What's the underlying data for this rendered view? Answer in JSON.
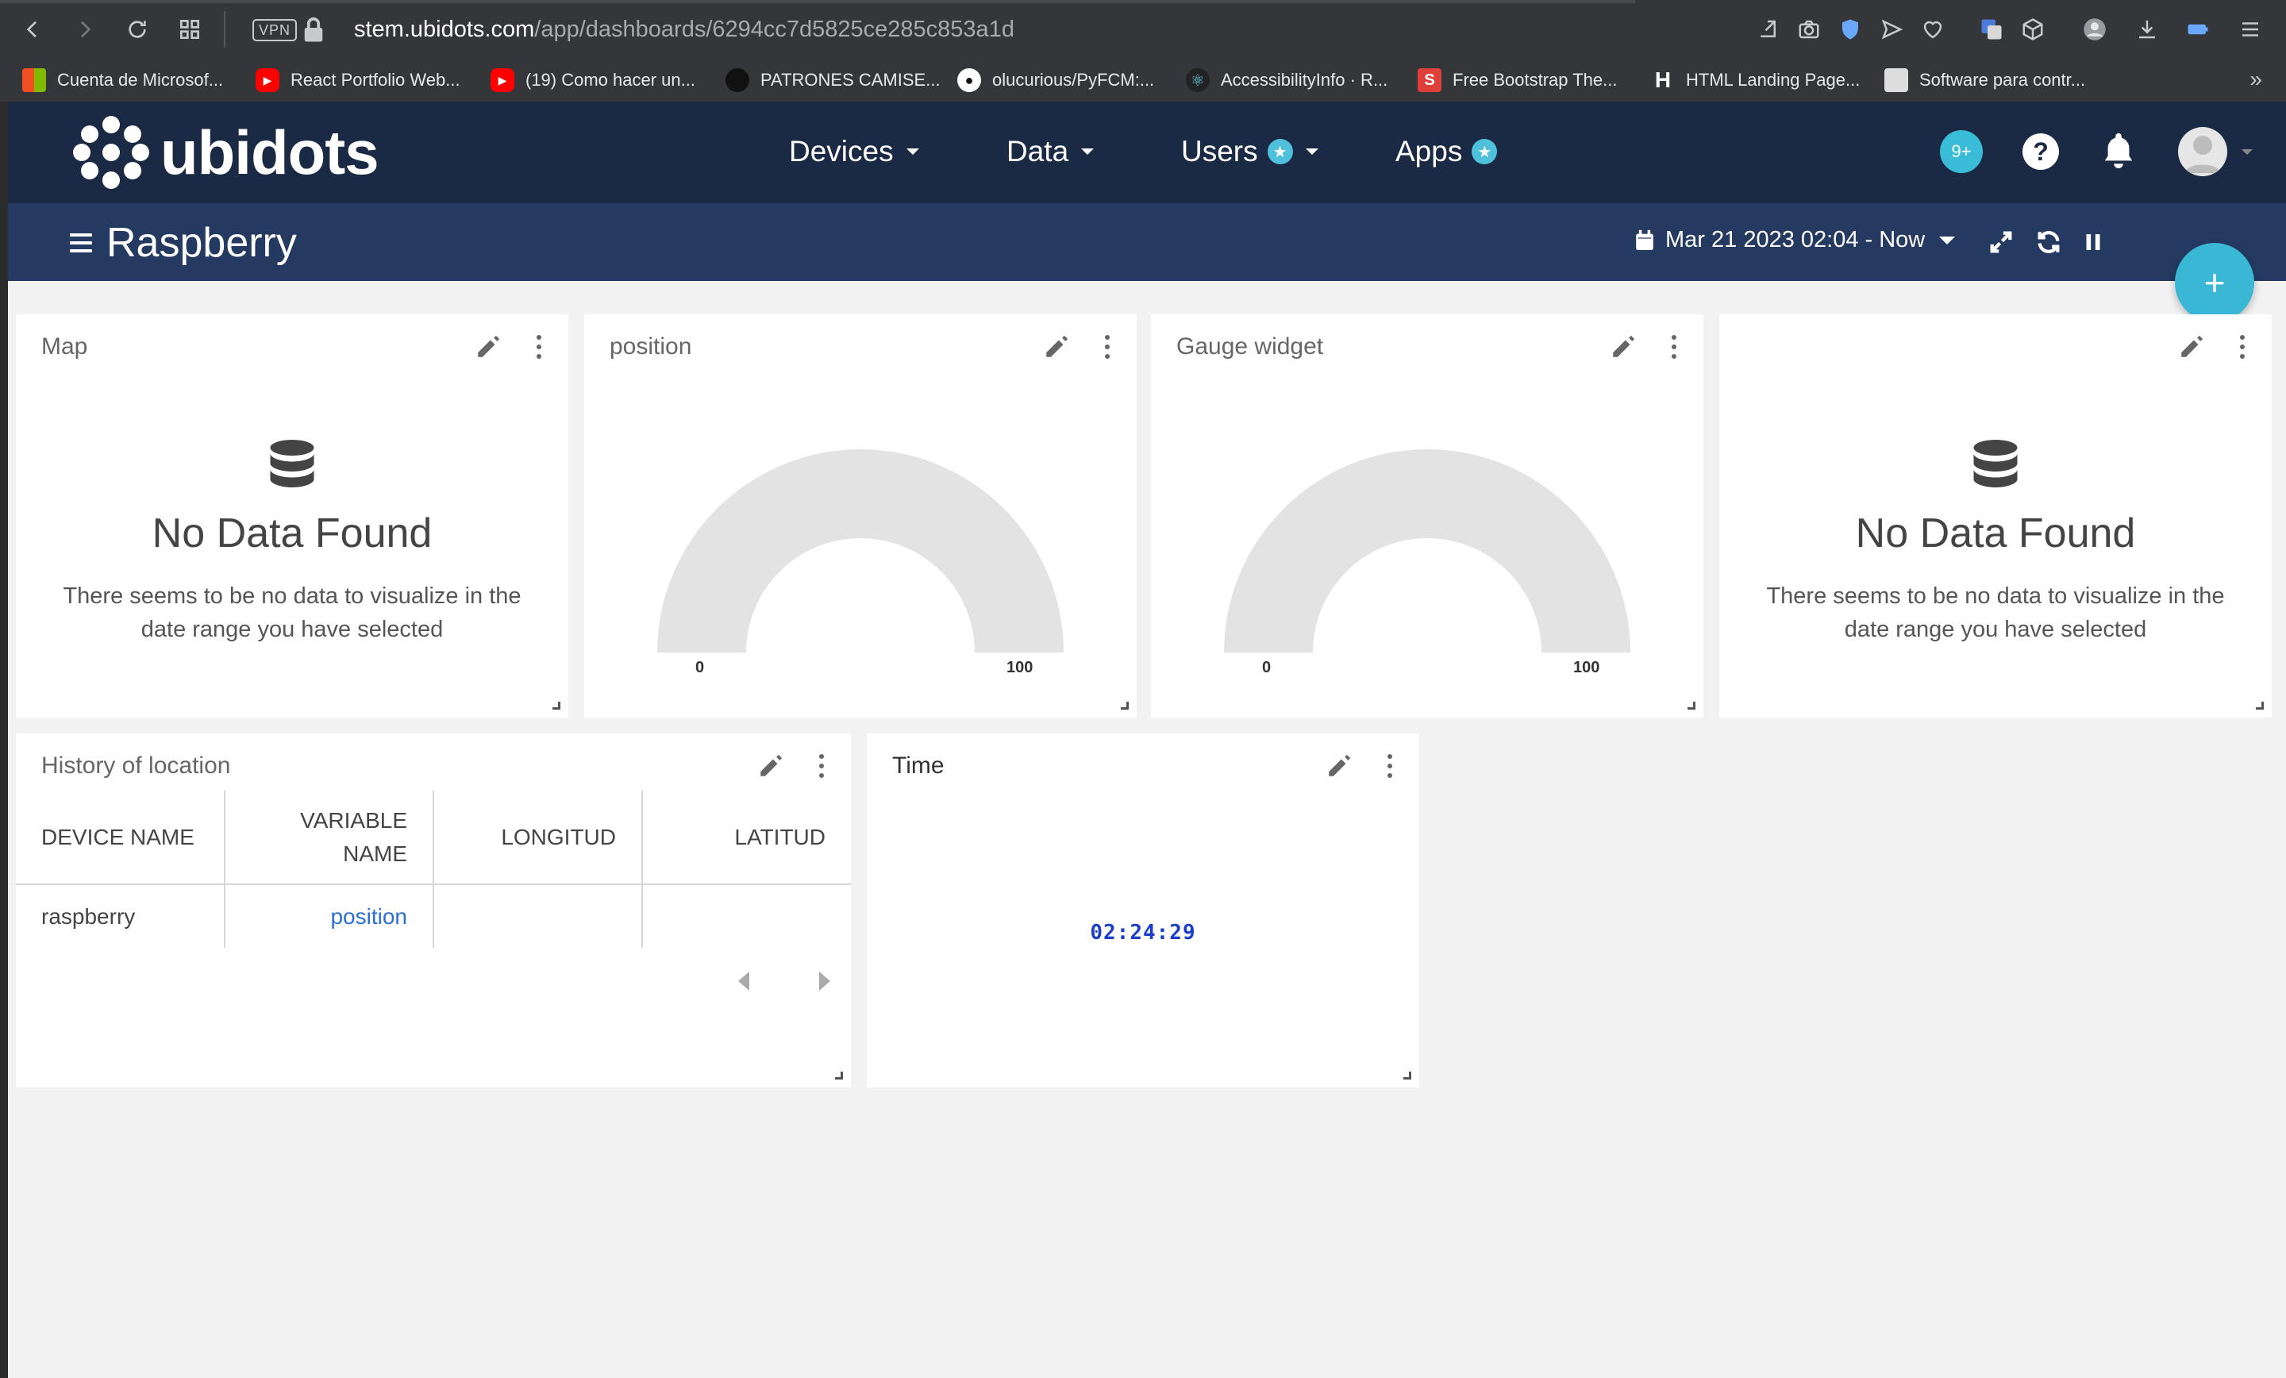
{
  "browser": {
    "url_host": "stem.ubidots.com",
    "url_path": "/app/dashboards/6294cc7d5825ce285c853a1d",
    "vpn_label": "VPN",
    "bookmarks": [
      {
        "label": "Cuenta de Microsof...",
        "icon": "microsoft-icon",
        "color": "#f25022"
      },
      {
        "label": "React Portfolio Web...",
        "icon": "youtube-icon",
        "color": "#ff0000"
      },
      {
        "label": "(19) Como hacer un...",
        "icon": "youtube-icon",
        "color": "#ff0000"
      },
      {
        "label": "PATRONES CAMISE...",
        "icon": "site-icon",
        "color": "#222222"
      },
      {
        "label": "olucurious/PyFCM:...",
        "icon": "github-icon",
        "color": "#ffffff"
      },
      {
        "label": "AccessibilityInfo · R...",
        "icon": "react-icon",
        "color": "#61dafb"
      },
      {
        "label": "Free Bootstrap The...",
        "icon": "s-logo-icon",
        "color": "#e0403a"
      },
      {
        "label": "HTML Landing Page...",
        "icon": "h-logo-icon",
        "color": "#ffffff"
      },
      {
        "label": "Software para contr...",
        "icon": "person-icon",
        "color": "#cccccc"
      }
    ],
    "more_label": "»"
  },
  "header": {
    "logo_text": "ubidots",
    "nav": [
      {
        "label": "Devices",
        "badge": false,
        "caret": true
      },
      {
        "label": "Data",
        "badge": false,
        "caret": true
      },
      {
        "label": "Users",
        "badge": true,
        "caret": true
      },
      {
        "label": "Apps",
        "badge": true,
        "caret": false
      }
    ],
    "notifications_badge": "9+",
    "help_label": "?"
  },
  "dashboard": {
    "title": "Raspberry",
    "date_range": "Mar 21 2023 02:04 - Now",
    "add_label": "+"
  },
  "widgets": {
    "map": {
      "title": "Map",
      "nodata_title": "No Data Found",
      "nodata_text": "There seems to be no data to visualize in the date range you have selected"
    },
    "position": {
      "title": "position",
      "min": "0",
      "max": "100",
      "value": null
    },
    "gauge": {
      "title": "Gauge widget",
      "min": "0",
      "max": "100",
      "value": null
    },
    "fourth": {
      "title": "",
      "nodata_title": "No Data Found",
      "nodata_text": "There seems to be no data to visualize in the date range you have selected"
    },
    "history": {
      "title": "History of location",
      "columns": [
        "DEVICE NAME",
        "VARIABLE NAME",
        "LONGITUD",
        "LATITUD"
      ],
      "rows": [
        {
          "device": "raspberry",
          "variable": "position",
          "longitud": "",
          "latitud": ""
        }
      ]
    },
    "time": {
      "title": "Time",
      "value": "02:24:29"
    }
  },
  "colors": {
    "nav_bg": "#1b2a44",
    "subbar_bg": "#243a61",
    "accent": "#3ab7d5",
    "link": "#2a6fd6",
    "clock": "#1a3ec8"
  }
}
